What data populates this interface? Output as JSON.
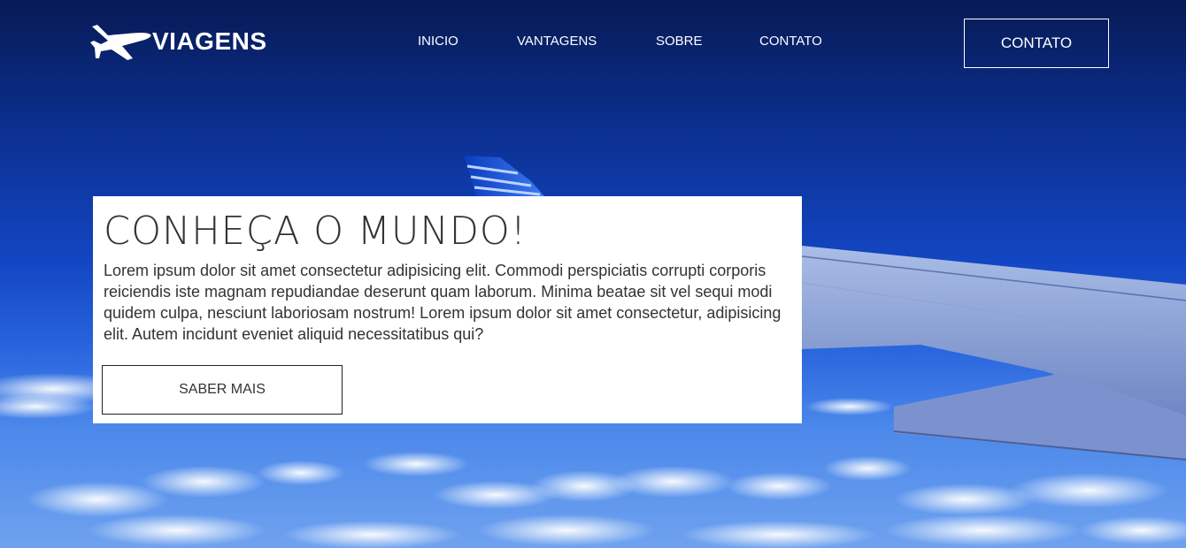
{
  "brand": {
    "logo_text": "VIAGENS",
    "logo_icon": "airplane-icon"
  },
  "nav": {
    "items": [
      {
        "label": "INICIO"
      },
      {
        "label": "VANTAGENS"
      },
      {
        "label": "SOBRE"
      },
      {
        "label": "CONTATO"
      }
    ]
  },
  "header_cta": {
    "label": "CONTATO"
  },
  "hero": {
    "title": "CONHEÇA O MUNDO!",
    "body": "Lorem ipsum dolor sit amet consectetur adipisicing elit. Commodi perspiciatis corrupti corporis reiciendis iste magnam repudiandae deserunt quam laborum. Minima beatae sit vel sequi modi quidem culpa, nesciunt laboriosam nostrum! Lorem ipsum dolor sit amet consectetur, adipisicing elit. Autem incidunt eveniet aliquid necessitatibus qui?",
    "button_label": "SABER MAIS"
  },
  "colors": {
    "sky_dark": "#071a55",
    "sky_mid": "#1346c4",
    "card_bg": "#ffffff",
    "text": "#333333"
  }
}
